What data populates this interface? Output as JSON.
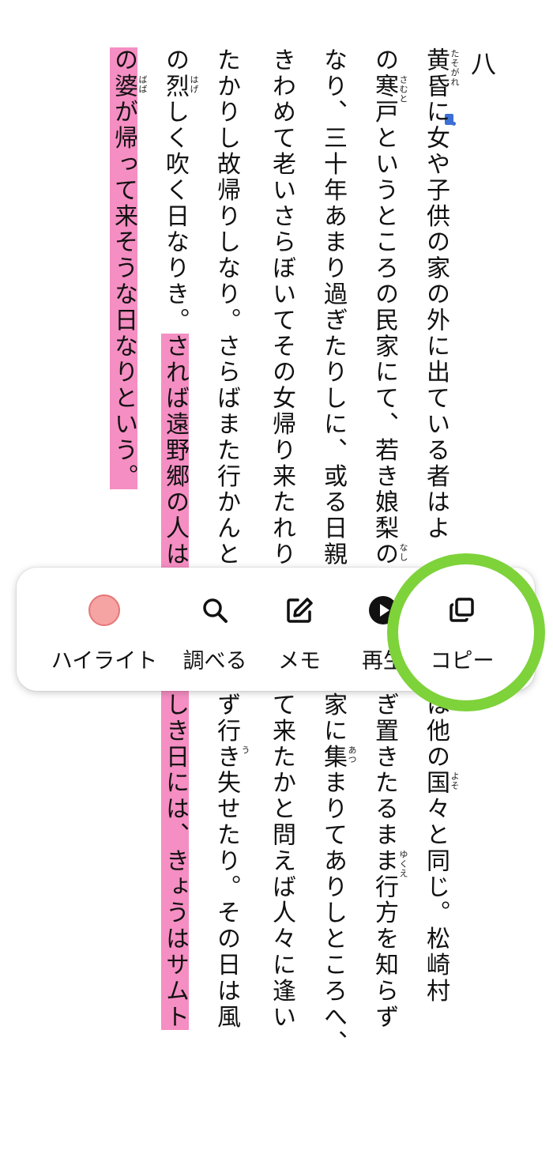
{
  "chapter": {
    "number": "八"
  },
  "columns": [
    {
      "segments": [
        {
          "text": "黄昏に女や子供の家の外に出ている者はよ",
          "hl": false
        },
        {
          "gap": true
        },
        {
          "text": "にあうことは他の国々と同じ。松崎村",
          "hl": false
        }
      ]
    },
    {
      "segments": [
        {
          "text": "の寒戸というところの民家にて、若き娘梨の",
          "hl": false
        },
        {
          "gap": true
        },
        {
          "text": "草履を脱ぎ置きたるまま行方を知らず",
          "hl": false
        }
      ]
    },
    {
      "segments": [
        {
          "text": "なり、三十年あまり過ぎたりしに、或る日親",
          "hl": false
        },
        {
          "gap": true
        },
        {
          "text": "人々その家に集まりてありしところへ、",
          "hl": false
        }
      ]
    },
    {
      "segments": [
        {
          "text": "きわめて老いさらぼいてその女帰り来たれり",
          "hl": false
        },
        {
          "gap": true
        },
        {
          "text": "して帰って来たかと問えば人々に逢い",
          "hl": false
        }
      ]
    },
    {
      "segments": [
        {
          "text": "たかりし故帰りしなり。さらばまた行かんと",
          "hl": false
        },
        {
          "gap": true
        },
        {
          "text": "跡を留めず行き失せたり。その日は風",
          "hl": false
        }
      ]
    },
    {
      "segments": [
        {
          "text": "の烈しく吹く日なりき。",
          "hl": false
        },
        {
          "text": "されば遠野郷の人は",
          "hl": true
        },
        {
          "gap": true,
          "hl": true
        },
        {
          "text": "風の騒がしき日には、きょうはサムト",
          "hl": true
        }
      ]
    },
    {
      "segments": [
        {
          "text": "の婆が帰って来そうな日なりという。",
          "hl": true
        }
      ]
    }
  ],
  "ruby": [
    {
      "text": "たそがれ",
      "col": 0,
      "char": 0
    },
    {
      "text": "さむと",
      "col": 1,
      "char": 1
    },
    {
      "text": "なし",
      "col": 1,
      "char": 19
    },
    {
      "text": "てうり",
      "col": 1,
      "char": 20
    },
    {
      "text": "ぬ",
      "col": 1,
      "char": 23
    },
    {
      "text": "ゆくえ",
      "col": 1,
      "char": 30
    },
    {
      "text": "よそ",
      "col": 0,
      "char": 27
    },
    {
      "text": "あつ",
      "col": 2,
      "char": 26
    },
    {
      "text": "あと",
      "col": 4,
      "char": 20
    },
    {
      "text": "とど",
      "col": 4,
      "char": 22
    },
    {
      "text": "う",
      "col": 4,
      "char": 26
    },
    {
      "text": "はげ",
      "col": 5,
      "char": 1
    },
    {
      "text": "ばば",
      "col": 6,
      "char": 1
    }
  ],
  "toolbar": {
    "items": [
      {
        "id": "highlight",
        "label": "ハイライト",
        "icon": "highlight-color-icon",
        "color": "#f5a3a3"
      },
      {
        "id": "lookup",
        "label": "調べる",
        "icon": "search-icon"
      },
      {
        "id": "memo",
        "label": "メモ",
        "icon": "edit-note-icon"
      },
      {
        "id": "play",
        "label": "再生",
        "icon": "play-icon"
      },
      {
        "id": "copy",
        "label": "コピー",
        "icon": "copy-icon"
      }
    ]
  },
  "colors": {
    "highlight": "#f58ec2",
    "focus_ring": "#7ed23a",
    "highlight_swatch": "#f5a3a3"
  }
}
